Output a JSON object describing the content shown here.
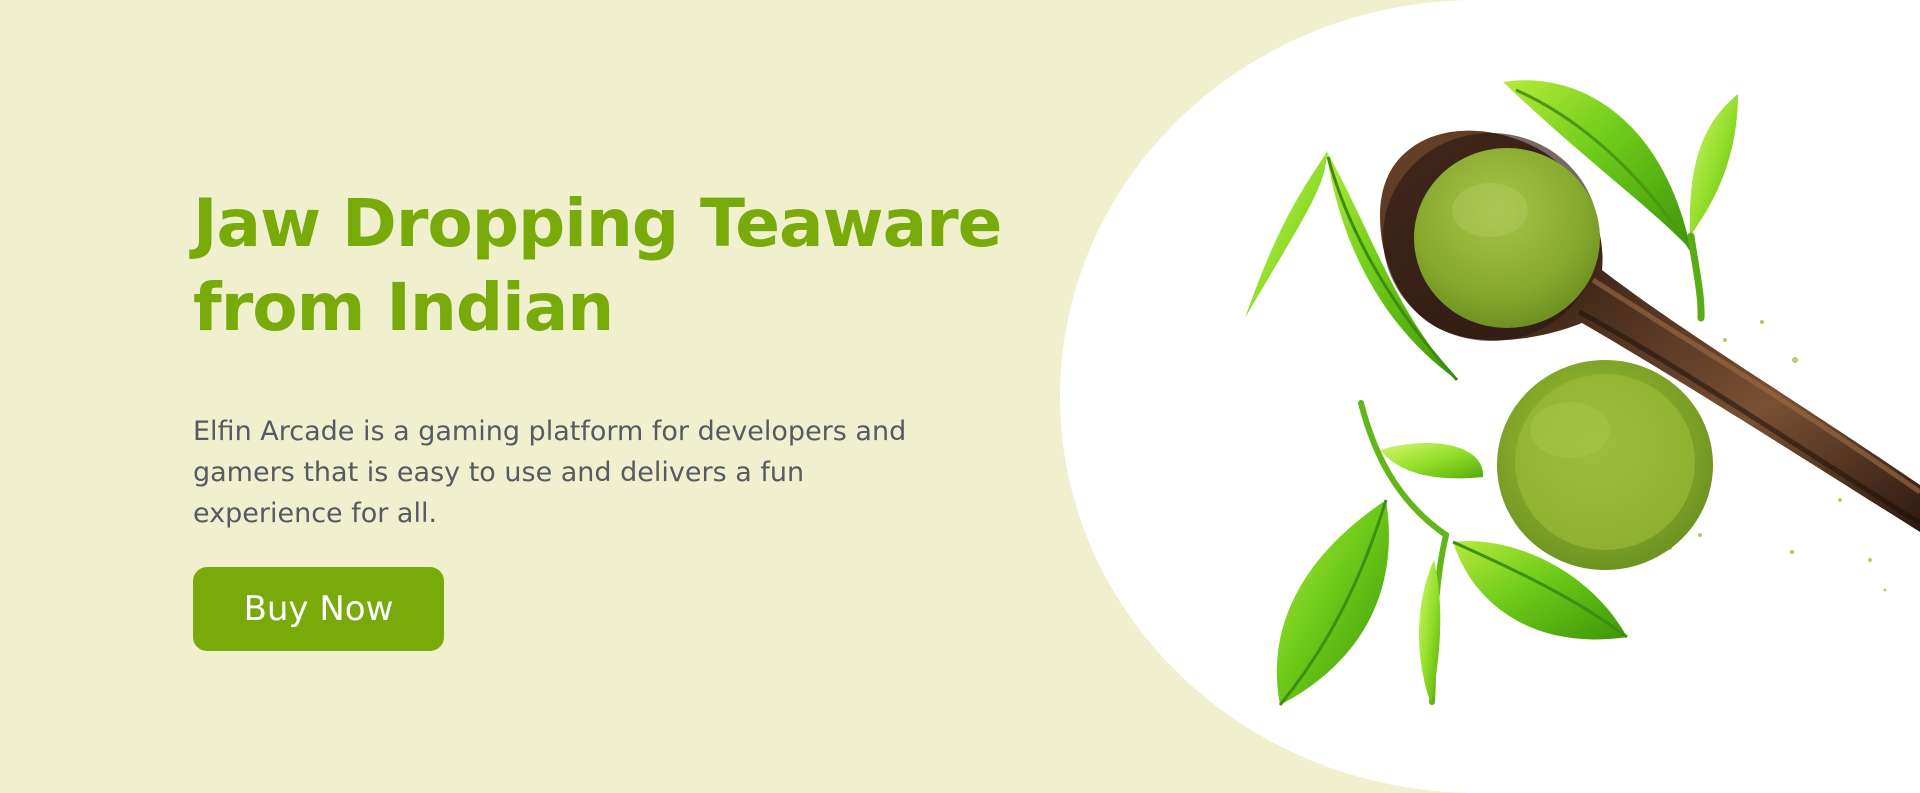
{
  "hero": {
    "title_line_1": "Jaw Dropping Teaware",
    "title_line_2": "from Indian",
    "description": "Elfin Arcade is a gaming platform for developers and gamers that is easy to use and delivers a fun experience for all.",
    "button_label": "Buy Now"
  },
  "colors": {
    "background": "#f0f0cf",
    "accent": "#78aa0a",
    "text": "#555b60",
    "image_panel": "#ffffff"
  },
  "image": {
    "subject": "green tea powder on wooden spoon with tea leaves"
  }
}
